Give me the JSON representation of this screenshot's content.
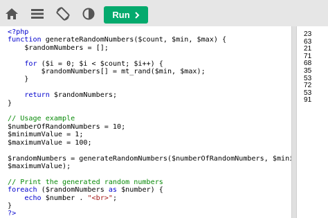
{
  "toolbar": {
    "icons": [
      "home-icon",
      "menu-icon",
      "rotate-icon",
      "theme-contrast-icon"
    ],
    "run_label": "Run",
    "run_icon": "chevron-right-icon",
    "accent_color": "#04aa6d"
  },
  "editor": {
    "lines": [
      "<?php",
      "function generateRandomNumbers($count, $min, $max) {",
      "    $randomNumbers = [];",
      "",
      "    for ($i = 0; $i < $count; $i++) {",
      "        $randomNumbers[] = mt_rand($min, $max);",
      "    }",
      "",
      "    return $randomNumbers;",
      "}",
      "",
      "// Usage example",
      "$numberOfRandomNumbers = 10;",
      "$minimumValue = 1;",
      "$maximumValue = 100;",
      "",
      "$randomNumbers = generateRandomNumbers($numberOfRandomNumbers, $minimumValue,",
      "$maximumValue);",
      "",
      "// Print the generated random numbers",
      "foreach ($randomNumbers as $number) {",
      "    echo $number . \"<br>\";",
      "}",
      "?>"
    ]
  },
  "output": {
    "values": [
      "23",
      "63",
      "21",
      "71",
      "68",
      "35",
      "53",
      "72",
      "53",
      "91"
    ]
  }
}
